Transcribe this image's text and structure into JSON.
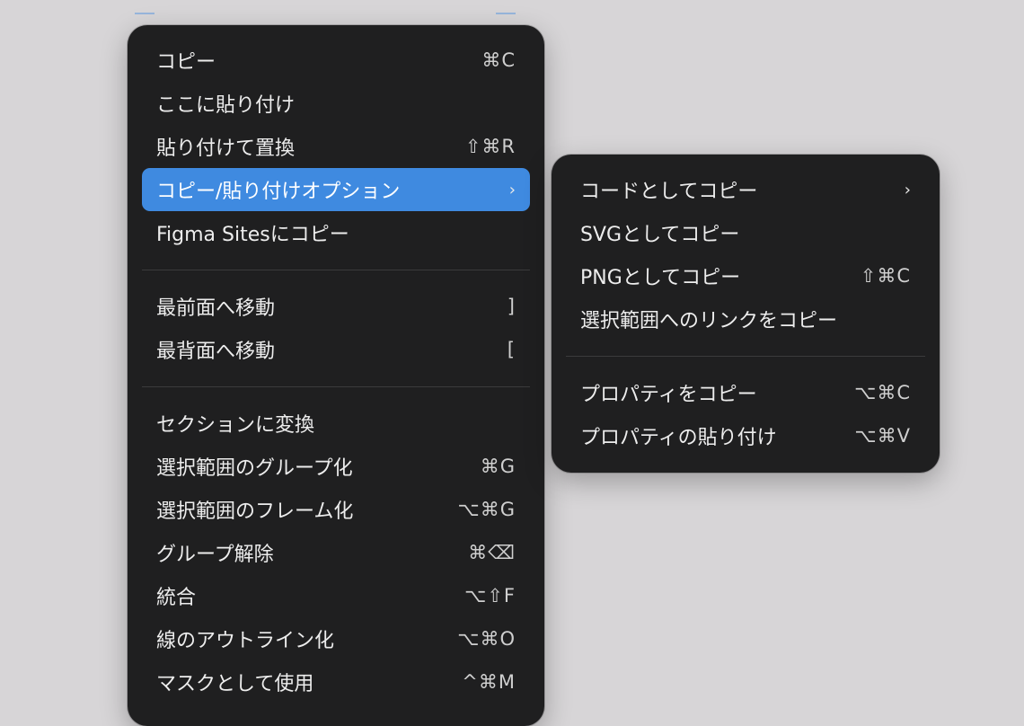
{
  "main_menu": {
    "items": [
      {
        "label": "コピー",
        "shortcut": "⌘C"
      },
      {
        "label": "ここに貼り付け",
        "shortcut": ""
      },
      {
        "label": "貼り付けて置換",
        "shortcut": "⇧⌘R"
      },
      {
        "label": "コピー/貼り付けオプション",
        "shortcut": "›"
      },
      {
        "label": "Figma Sitesにコピー",
        "shortcut": ""
      },
      {
        "label": "最前面へ移動",
        "shortcut": "]"
      },
      {
        "label": "最背面へ移動",
        "shortcut": "["
      },
      {
        "label": "セクションに変換",
        "shortcut": ""
      },
      {
        "label": "選択範囲のグループ化",
        "shortcut": "⌘G"
      },
      {
        "label": "選択範囲のフレーム化",
        "shortcut": "⌥⌘G"
      },
      {
        "label": "グループ解除",
        "shortcut": "⌘⌫"
      },
      {
        "label": "統合",
        "shortcut": "⌥⇧F"
      },
      {
        "label": "線のアウトライン化",
        "shortcut": "⌥⌘O"
      },
      {
        "label": "マスクとして使用",
        "shortcut": "^⌘M"
      }
    ]
  },
  "sub_menu": {
    "items": [
      {
        "label": "コードとしてコピー",
        "shortcut": "›"
      },
      {
        "label": "SVGとしてコピー",
        "shortcut": ""
      },
      {
        "label": "PNGとしてコピー",
        "shortcut": "⇧⌘C"
      },
      {
        "label": "選択範囲へのリンクをコピー",
        "shortcut": ""
      },
      {
        "label": "プロパティをコピー",
        "shortcut": "⌥⌘C"
      },
      {
        "label": "プロパティの貼り付け",
        "shortcut": "⌥⌘V"
      }
    ]
  },
  "colors": {
    "menu_background": "#1f1f20",
    "highlight": "#3f8ae0",
    "page_background": "#d7d5d7"
  }
}
